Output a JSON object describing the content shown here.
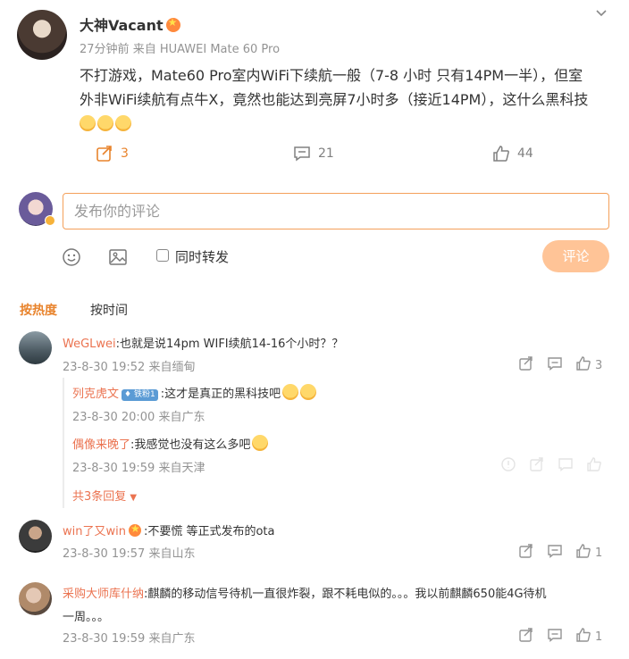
{
  "post": {
    "author": "大神Vacant",
    "time": "27分钟前",
    "source": "来自 HUAWEI Mate 60 Pro",
    "text_line1": "不打游戏，Mate60 Pro室内WiFi下续航一般（7-8 小时 只有14PM一半），但室",
    "text_line2": "外非WiFi续航有点牛X，竟然也能达到亮屏7小时多（接近14PM），这什么黑科技",
    "emoji_icon": "grin-sweat-emoji",
    "repost_count": "3",
    "comment_count": "21",
    "like_count": "44"
  },
  "composer": {
    "placeholder": "发布你的评论",
    "forward_label": "同时转发",
    "submit_label": "评论"
  },
  "sort_tabs": {
    "hot": "按热度",
    "time": "按时间"
  },
  "comments": [
    {
      "user": "WeGLwei",
      "text": ":也就是说14pm WIFI续航14-16个小时？？",
      "time": "23-8-30 19:52",
      "source": "来自缅甸",
      "likes": "3",
      "replies": [
        {
          "user": "列克虎文",
          "badge": "铁粉1",
          "text": ":这才是真正的黑科技吧",
          "time": "23-8-30 20:00",
          "source": "来自广东"
        },
        {
          "user": "偶像来晚了",
          "text": ":我感觉也没有这么多吧",
          "time": "23-8-30 19:59",
          "source": "来自天津"
        }
      ],
      "more_replies": "共3条回复"
    },
    {
      "user": "win了又win",
      "text": ":不要慌 等正式发布的ota",
      "time": "23-8-30 19:57",
      "source": "来自山东",
      "likes": "1"
    },
    {
      "user": "采购大师库什纳",
      "text_line1": ":麒麟的移动信号待机一直很炸裂，跟不耗电似的。。。我以前麒麟650能4G待机",
      "text_line2": "一周。。。",
      "time": "23-8-30 19:59",
      "source": "来自广东",
      "likes": "1"
    }
  ],
  "colors": {
    "accent_orange": "#e8832c",
    "username": "#eb7350",
    "muted": "#939393",
    "submit_bg": "#ffc497",
    "composer_border": "#f4a05a"
  }
}
